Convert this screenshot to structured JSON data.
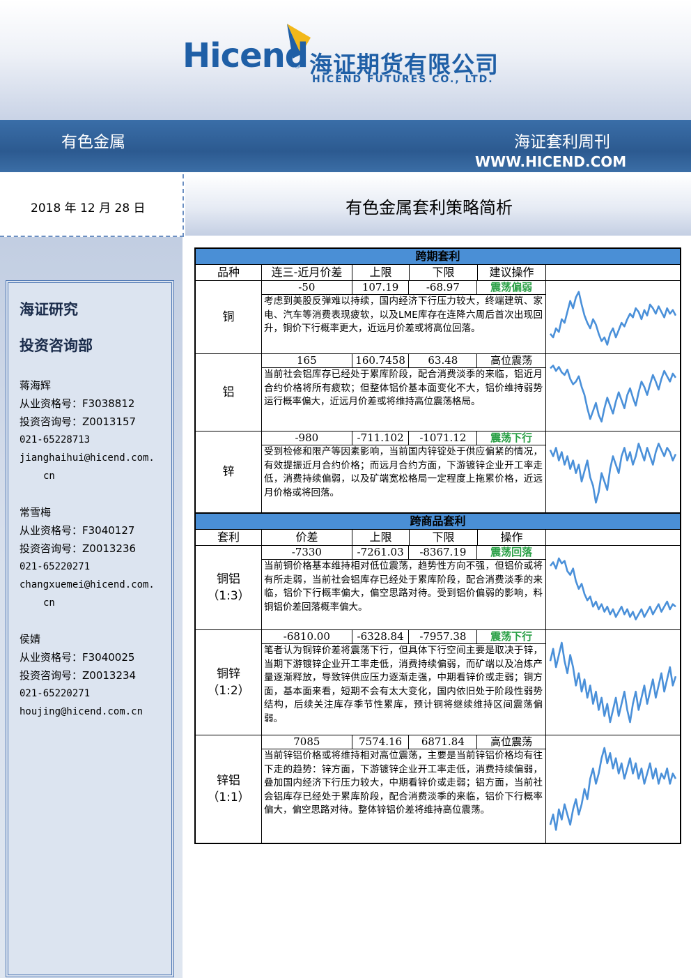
{
  "header": {
    "logo_text": "Hicend",
    "logo_reg": "®",
    "company_cn": "海证期货有限公司",
    "company_en": "HICEND  FUTURES  CO.,  LTD.",
    "category": "有色金属",
    "publication": "海证套利周刊",
    "website": "WWW.HICEND.COM"
  },
  "date": "2018 年 12 月 28 日",
  "title": "有色金属套利策略简析",
  "sidebar": {
    "dept_line1": "海证研究",
    "dept_line2": "投资咨询部",
    "analysts": [
      {
        "name": "蒋海辉",
        "qual": "从业资格号：F3038812",
        "consult": "投资咨询号：Z0013157",
        "phone": "021-65228713",
        "email1": "jianghaihui@hicend.com.",
        "email2": "cn"
      },
      {
        "name": "常雪梅",
        "qual": "从业资格号：F3040127",
        "consult": "投资咨询号：Z0013236",
        "phone": "021-65220271",
        "email1": "changxuemei@hicend.com.",
        "email2": "cn"
      },
      {
        "name": "侯婧",
        "qual": "从业资格号：F3040025",
        "consult": "投资咨询号：Z0013234",
        "phone": "021-65220271",
        "email1": "houjing@hicend.com.cn",
        "email2": ""
      }
    ]
  },
  "intertemporal": {
    "section_title": "跨期套利",
    "headers": [
      "品种",
      "连三-近月价差",
      "上限",
      "下限",
      "建议操作"
    ],
    "rows": [
      {
        "name": "铜",
        "spread": "-50",
        "upper": "107.19",
        "lower": "-68.97",
        "op": "震荡偏弱",
        "op_green": true,
        "desc": "考虑到美股反弹难以持续，国内经济下行压力较大，终端建筑、家电、汽车等消费表现疲软，以及LME库存在连降六周后首次出现回升，铜价下行概率更大，近远月价差或将高位回落。"
      },
      {
        "name": "铝",
        "spread": "165",
        "upper": "160.7458",
        "lower": "63.48",
        "op": "高位震荡",
        "op_green": false,
        "desc": "当前社会铝库存已经处于累库阶段，配合消费淡季的来临，铝近月合约价格将所有疲软；但整体铝价基本面变化不大，铝价维持弱势运行概率偏大，近远月价差或将维持高位震荡格局。"
      },
      {
        "name": "锌",
        "spread": "-980",
        "upper": "-711.102",
        "lower": "-1071.12",
        "op": "震荡下行",
        "op_green": true,
        "desc": "受到检修和限产等因素影响，当前国内锌锭处于供应偏紧的情况，有效提振近月合约价格；而远月合约方面，下游镀锌企业开工率走低，消费持续偏弱，以及矿端宽松格局一定程度上拖累价格，近远月价格或将回落。"
      }
    ]
  },
  "intercommodity": {
    "section_title": "跨商品套利",
    "headers": [
      "套利",
      "价差",
      "上限",
      "下限",
      "操作"
    ],
    "rows": [
      {
        "name": "铜铝",
        "ratio": "（1:3）",
        "spread": "-7330",
        "upper": "-7261.03",
        "lower": "-8367.19",
        "op": "震荡回落",
        "op_green": true,
        "desc": "当前铜价格基本维持相对低位震荡，趋势性方向不强，但铝价或将有所走弱，当前社会铝库存已经处于累库阶段，配合消费淡季的来临，铝价下行概率偏大，偏空思路对待。受到铝价偏弱的影响，料铜铝价差回落概率偏大。"
      },
      {
        "name": "铜锌",
        "ratio": "（1:2）",
        "spread": "-6810.00",
        "upper": "-6328.84",
        "lower": "-7957.38",
        "op": "震荡下行",
        "op_green": true,
        "desc": "笔者认为铜锌价差将震荡下行，但具体下行空间主要是取决于锌，当期下游镀锌企业开工率走低，消费持续偏弱，而矿端以及冶炼产量逐渐释放，导致锌供应压力逐渐走强，中期看锌价或走弱；铜方面，基本面来看，短期不会有太大变化，国内依旧处于阶段性弱势结构，后续关注库存季节性累库，预计铜将继续维持区间震荡偏弱。"
      },
      {
        "name": "锌铝",
        "ratio": "（1:1）",
        "spread": "7085",
        "upper": "7574.16",
        "lower": "6871.84",
        "op": "高位震荡",
        "op_green": false,
        "desc": "当前锌铝价格或将维持相对高位震荡，主要是当前锌铝价格均有往下走的趋势：锌方面，下游镀锌企业开工率走低，消费持续偏弱，叠加国内经济下行压力较大，中期看锌价或走弱；铝方面，当前社会铝库存已经处于累库阶段，配合消费淡季的来临，铝价下行概率偏大，偏空思路对待。整体锌铝价差将维持高位震荡。"
      }
    ]
  },
  "chart_data": [
    {
      "type": "line",
      "series": [
        {
          "values": [
            52,
            50,
            55,
            53,
            60,
            58,
            64,
            70,
            66,
            72,
            75,
            68,
            62,
            58,
            55,
            60,
            57,
            52,
            48,
            50,
            46,
            52,
            55,
            50,
            54,
            58,
            56,
            60,
            63,
            61,
            66,
            64,
            60,
            65,
            62,
            68,
            66,
            63,
            67,
            64,
            61,
            66,
            63,
            65,
            62
          ]
        }
      ]
    },
    {
      "type": "line",
      "series": [
        {
          "values": [
            60,
            62,
            58,
            61,
            57,
            55,
            59,
            52,
            48,
            50,
            54,
            46,
            40,
            30,
            22,
            28,
            34,
            25,
            20,
            30,
            38,
            32,
            26,
            35,
            42,
            36,
            30,
            40,
            45,
            38,
            32,
            42,
            50,
            46,
            40,
            48,
            55,
            50,
            44,
            52,
            58,
            54,
            50,
            56,
            53
          ]
        }
      ]
    },
    {
      "type": "line",
      "series": [
        {
          "values": [
            55,
            52,
            56,
            50,
            54,
            48,
            52,
            46,
            50,
            44,
            48,
            40,
            45,
            50,
            42,
            38,
            30,
            35,
            44,
            40,
            36,
            46,
            52,
            48,
            44,
            52,
            56,
            50,
            54,
            48,
            52,
            58,
            54,
            50,
            56,
            52,
            48,
            54,
            58,
            55,
            52,
            56,
            54,
            50,
            53
          ]
        }
      ]
    },
    {
      "type": "line",
      "series": [
        {
          "values": [
            62,
            65,
            60,
            68,
            64,
            66,
            58,
            55,
            60,
            50,
            44,
            48,
            40,
            35,
            38,
            30,
            34,
            28,
            32,
            26,
            30,
            24,
            28,
            22,
            26,
            30,
            24,
            28,
            22,
            26,
            20,
            24,
            28,
            22,
            26,
            30,
            24,
            28,
            32,
            26,
            30,
            34,
            28,
            32,
            30
          ]
        }
      ]
    },
    {
      "type": "line",
      "series": [
        {
          "values": [
            50,
            54,
            48,
            52,
            56,
            50,
            46,
            52,
            48,
            42,
            46,
            40,
            44,
            38,
            42,
            36,
            40,
            34,
            38,
            32,
            36,
            30,
            34,
            38,
            32,
            36,
            40,
            34,
            30,
            36,
            40,
            34,
            38,
            42,
            36,
            40,
            44,
            38,
            42,
            46,
            40,
            44,
            48,
            42,
            45
          ]
        }
      ]
    },
    {
      "type": "line",
      "series": [
        {
          "values": [
            30,
            34,
            28,
            36,
            32,
            38,
            34,
            30,
            36,
            40,
            34,
            38,
            44,
            40,
            48,
            52,
            46,
            50,
            56,
            60,
            54,
            58,
            52,
            56,
            50,
            54,
            48,
            52,
            56,
            50,
            54,
            48,
            52,
            46,
            50,
            54,
            48,
            52,
            46,
            50,
            48,
            52,
            46,
            50,
            48
          ]
        }
      ]
    }
  ],
  "colors": {
    "band": "#2c5a90",
    "section_head": "#4a8fd6",
    "green": "#2aa046",
    "line": "#4a90d9"
  }
}
